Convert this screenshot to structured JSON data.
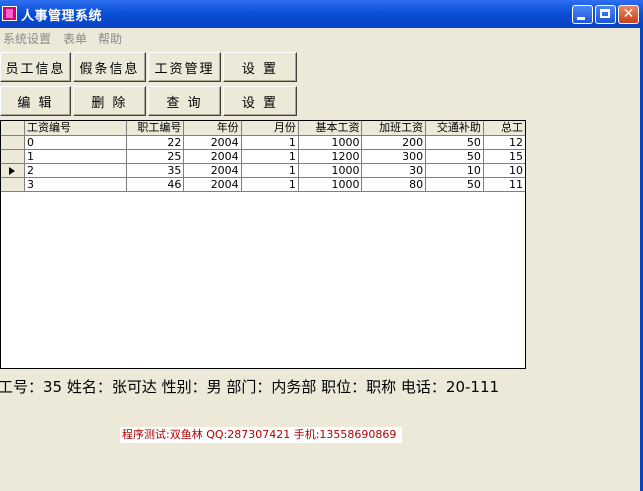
{
  "window": {
    "title": "人事管理系统",
    "close_glyph": "✕"
  },
  "menu": [
    "系统设置",
    "表单",
    "帮助"
  ],
  "toolbar_row1": [
    "员工信息",
    "假条信息",
    "工资管理",
    "设 置"
  ],
  "toolbar_row2": [
    "编 辑",
    "删 除",
    "查 询",
    "设 置"
  ],
  "grid": {
    "columns": [
      "工资编号",
      "职工编号",
      "年份",
      "月份",
      "基本工资",
      "加班工资",
      "交通补助",
      "总工"
    ],
    "rows": [
      [
        "0",
        "22",
        "2004",
        "1",
        "1000",
        "200",
        "50",
        "12"
      ],
      [
        "1",
        "25",
        "2004",
        "1",
        "1200",
        "300",
        "50",
        "15"
      ],
      [
        "2",
        "35",
        "2004",
        "1",
        "1000",
        "30",
        "10",
        "10"
      ],
      [
        "3",
        "46",
        "2004",
        "1",
        "1000",
        "80",
        "50",
        "11"
      ]
    ],
    "current_row": 2
  },
  "info_line": "工号：35 姓名：张可达 性别：男 部门：内务部 职位：职称 电话：20-111",
  "footer_note": "程序测试:双鱼林 QQ:287307421 手机:13558690869",
  "colors": {
    "titlebar": "#0a4fd6",
    "face": "#ece9d8",
    "note_text": "#b00000"
  }
}
